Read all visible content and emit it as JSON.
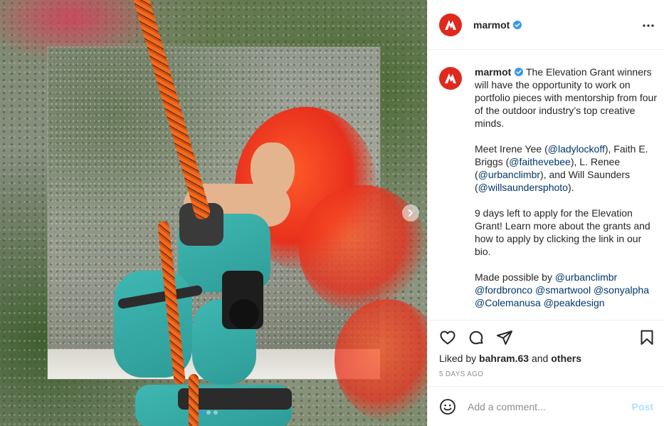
{
  "post": {
    "username": "marmot",
    "verified": true,
    "more_icon": "more-horizontal-icon",
    "caption_intro": "The Elevation Grant winners will have the opportunity to work on portfolio pieces with mentorship from four of the outdoor industry’s top creative minds.",
    "para2": {
      "t1": "Meet Irene Yee (",
      "m1": "@ladylockoff",
      "t2": "), Faith E. Briggs (",
      "m2": "@faithevebee",
      "t3": "), L. Renee (",
      "m3": "@urbanclimbr",
      "t4": "), and Will Saunders (",
      "m4": "@willsaundersphoto",
      "t5": ")."
    },
    "para3": "9 days left to apply for the Elevation Grant! Learn more about the grants and how to apply by clicking the link in our bio.",
    "para4": {
      "t1": "Made possible by ",
      "m1": "@urbanclimbr",
      "m2": "@fordbronco",
      "m3": "@smartwool",
      "m4": "@sonyalpha",
      "m5": "@Colemanusa",
      "m6": "@peakdesign"
    },
    "likes": {
      "prefix": "Liked by ",
      "user": "bahram.63",
      "mid": " and ",
      "others": "others"
    },
    "time": "5 DAYS AGO",
    "comment_placeholder": "Add a comment...",
    "post_label": "Post"
  },
  "carousel": {
    "next_icon": "chevron-right-icon",
    "dots": 3,
    "active_index": 0
  },
  "colors": {
    "brand_red": "#e0291c",
    "verified_blue": "#3897f0",
    "mention": "#00376b",
    "post_disabled": "#b2dffc"
  }
}
